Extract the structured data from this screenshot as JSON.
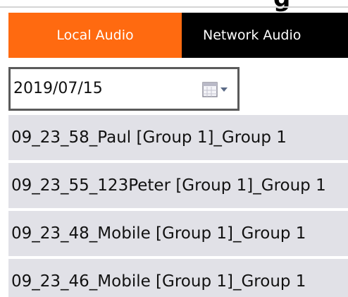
{
  "window": {
    "title_fragment": "g"
  },
  "tabs": [
    {
      "label": "Local Audio",
      "active": true
    },
    {
      "label": "Network Audio",
      "active": false
    }
  ],
  "date_picker": {
    "value": "2019/07/15",
    "icon": "calendar-icon"
  },
  "recordings": [
    {
      "label": "09_23_58_Paul [Group 1]_Group 1"
    },
    {
      "label": "09_23_55_123Peter [Group 1]_Group 1"
    },
    {
      "label": "09_23_48_Mobile [Group 1]_Group 1"
    },
    {
      "label": "09_23_46_Mobile [Group 1]_Group 1"
    }
  ],
  "colors": {
    "tab_active_bg": "#ff6a10",
    "tab_inactive_bg": "#000000",
    "list_item_bg": "#e1e1e7",
    "date_border": "#5a5a5a"
  }
}
